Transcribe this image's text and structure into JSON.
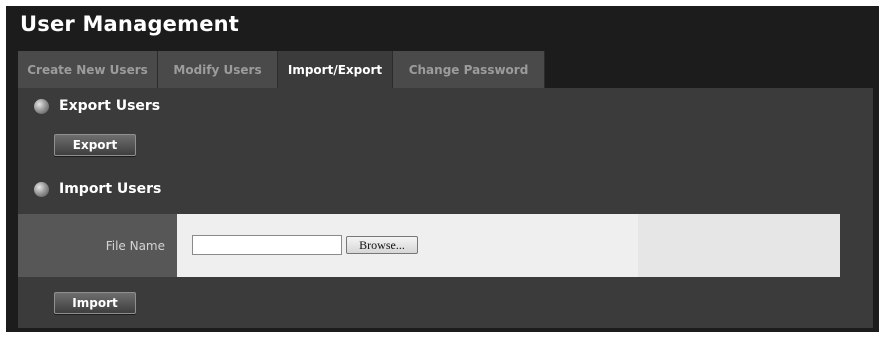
{
  "title": "User Management",
  "tabs": [
    {
      "label": "Create New Users",
      "active": false
    },
    {
      "label": "Modify Users",
      "active": false
    },
    {
      "label": "Import/Export",
      "active": true
    },
    {
      "label": "Change Password",
      "active": false
    }
  ],
  "export_section": {
    "heading": "Export Users",
    "button_label": "Export"
  },
  "import_section": {
    "heading": "Import Users",
    "file_label": "File Name",
    "file_value": "",
    "browse_label": "Browse...",
    "button_label": "Import"
  }
}
